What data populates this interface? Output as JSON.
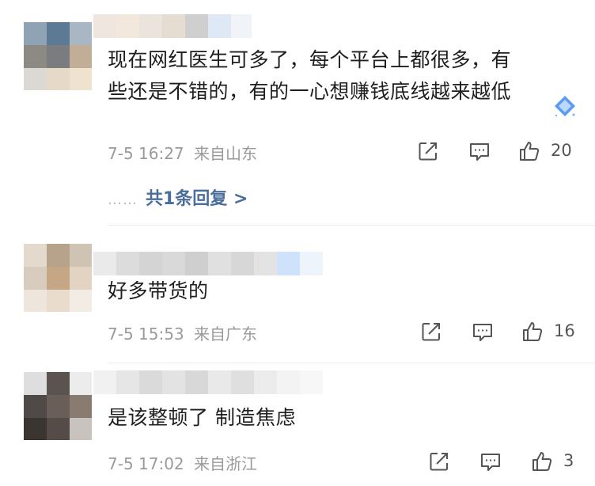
{
  "comments": [
    {
      "lines": [
        "现在网红医生可多了，每个平台上都很多，有",
        "些还是不错的，有的一心想赚钱底线越来越低"
      ],
      "time": "7-5 16:27",
      "location": "来自山东",
      "likes": "20",
      "replies_label": "共1条回复 >",
      "replies_dots": "……"
    },
    {
      "lines": [
        "好多带货的"
      ],
      "time": "7-5 15:53",
      "location": "来自广东",
      "likes": "16"
    },
    {
      "lines": [
        "是该整顿了 制造焦虑"
      ],
      "time": "7-5 17:02",
      "location": "来自浙江",
      "likes": "3"
    }
  ],
  "icons": {
    "share": "share-icon",
    "comment": "comment-icon",
    "like": "thumbs-up-icon",
    "badge": "diamond-badge-icon"
  },
  "colors": {
    "meta_text": "#9a9a9a",
    "reply_link": "#4a6d9c",
    "badge": "#5b9bf0"
  }
}
